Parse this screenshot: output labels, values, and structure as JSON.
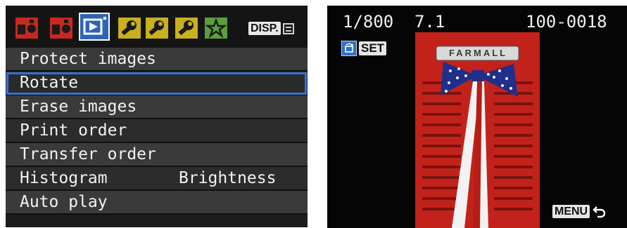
{
  "menu_screen": {
    "tabs": [
      {
        "id": "shooting-1",
        "icon": "camera-red-icon",
        "color": "#c8281e"
      },
      {
        "id": "shooting-2",
        "icon": "camera-red-icon",
        "color": "#c8281e"
      },
      {
        "id": "playback",
        "icon": "playback-blue-icon",
        "color": "#2f63b4",
        "selected": true
      },
      {
        "id": "setup-1",
        "icon": "wrench-yellow-icon",
        "color": "#c8b01e"
      },
      {
        "id": "setup-2",
        "icon": "wrench-yellow-icon",
        "color": "#c8b01e"
      },
      {
        "id": "setup-3",
        "icon": "wrench-yellow-icon",
        "color": "#c8b01e"
      },
      {
        "id": "my-menu",
        "icon": "star-green-icon",
        "color": "#5aa03a"
      }
    ],
    "disp_label": "DISP.",
    "items": [
      {
        "label": "Protect images",
        "value": ""
      },
      {
        "label": "Rotate",
        "value": "",
        "selected": true
      },
      {
        "label": "Erase images",
        "value": ""
      },
      {
        "label": "Print order",
        "value": ""
      },
      {
        "label": "Transfer order",
        "value": ""
      },
      {
        "label": "Histogram",
        "value": "Brightness"
      },
      {
        "label": "Auto play",
        "value": ""
      }
    ]
  },
  "review_screen": {
    "shutter_speed": "1/800",
    "aperture": "7.1",
    "file_number": "100-0018",
    "set_label": "SET",
    "menu_label": "MENU",
    "photo_sign_text": "FARMALL"
  }
}
